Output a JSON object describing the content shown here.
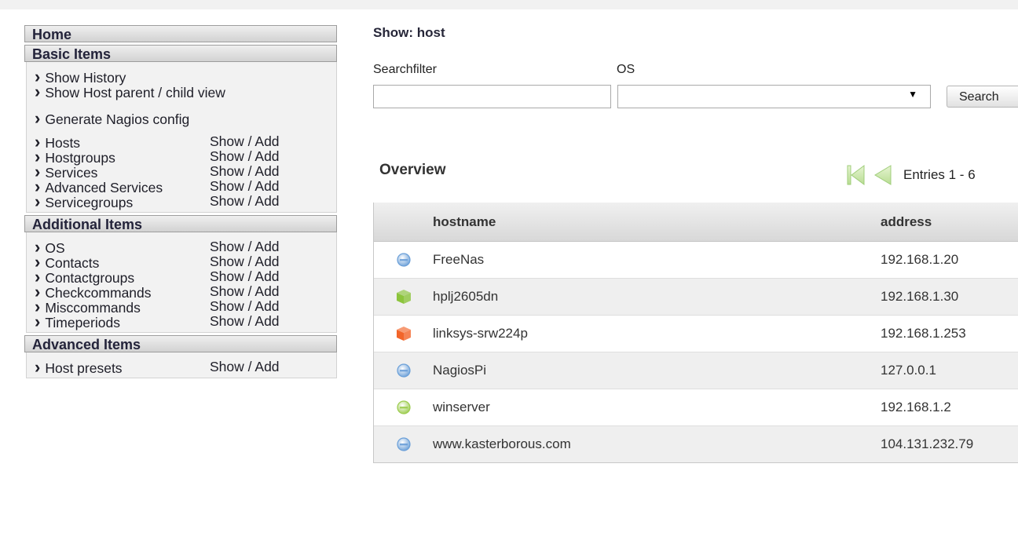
{
  "sidebar": {
    "home": "Home",
    "sections": [
      {
        "title": "Basic Items",
        "groups": [
          [
            {
              "label": "Show History",
              "link": ""
            },
            {
              "label": "Show Host parent / child view",
              "link": ""
            }
          ],
          [
            {
              "label": "Generate Nagios config",
              "link": ""
            }
          ],
          [
            {
              "label": "Hosts",
              "link": "Show / Add"
            },
            {
              "label": "Hostgroups",
              "link": "Show / Add"
            },
            {
              "label": "Services",
              "link": "Show / Add"
            },
            {
              "label": "Advanced Services",
              "link": "Show / Add"
            },
            {
              "label": "Servicegroups",
              "link": "Show / Add"
            }
          ]
        ]
      },
      {
        "title": "Additional Items",
        "groups": [
          [
            {
              "label": "OS",
              "link": "Show / Add"
            },
            {
              "label": "Contacts",
              "link": "Show / Add"
            },
            {
              "label": "Contactgroups",
              "link": "Show / Add"
            },
            {
              "label": "Checkcommands",
              "link": "Show / Add"
            },
            {
              "label": "Misccommands",
              "link": "Show / Add"
            },
            {
              "label": "Timeperiods",
              "link": "Show / Add"
            }
          ]
        ]
      },
      {
        "title": "Advanced Items",
        "groups": [
          [
            {
              "label": "Host presets",
              "link": "Show / Add"
            }
          ]
        ]
      }
    ]
  },
  "main": {
    "title": "Show: host",
    "filters": {
      "searchfilter_label": "Searchfilter",
      "searchfilter_value": "",
      "os_label": "OS",
      "os_value": "",
      "search_button": "Search"
    },
    "overview": {
      "title": "Overview",
      "entries": "Entries 1 - 6"
    },
    "table": {
      "columns": [
        "hostname",
        "address"
      ],
      "rows": [
        {
          "icon": "blue-sphere-icon",
          "hostname": "FreeNas",
          "address": "192.168.1.20"
        },
        {
          "icon": "green-cube-icon",
          "hostname": "hplj2605dn",
          "address": "192.168.1.30"
        },
        {
          "icon": "orange-cube-icon",
          "hostname": "linksys-srw224p",
          "address": "192.168.1.253"
        },
        {
          "icon": "blue-sphere-icon",
          "hostname": "NagiosPi",
          "address": "127.0.0.1"
        },
        {
          "icon": "green-sphere-icon",
          "hostname": "winserver",
          "address": "192.168.1.2"
        },
        {
          "icon": "blue-sphere-icon",
          "hostname": "www.kasterborous.com",
          "address": "104.131.232.79"
        }
      ]
    }
  },
  "colors": {
    "blue_sphere": "#6a9fd8",
    "green_sphere": "#9ccc4e",
    "green_cube": "#8cc43c",
    "orange_cube": "#f2652a"
  }
}
